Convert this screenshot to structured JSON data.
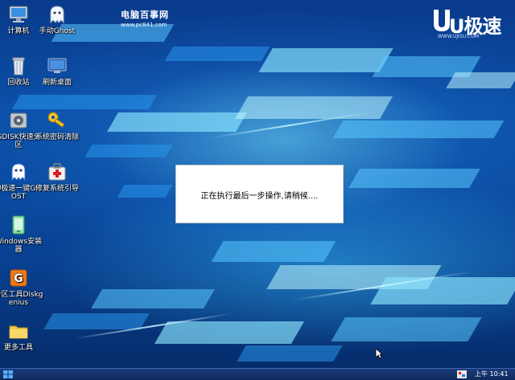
{
  "desktop": {
    "icons": [
      {
        "label": "计算机",
        "icon": "computer-icon"
      },
      {
        "label": "手动Ghost",
        "icon": "ghost-icon"
      },
      {
        "label": "回收站",
        "icon": "recycle-bin-icon"
      },
      {
        "label": "刷新桌面",
        "icon": "refresh-desktop-icon"
      },
      {
        "label": "GDISK快速分区",
        "icon": "gdisk-icon"
      },
      {
        "label": "系统密码清除",
        "icon": "key-icon"
      },
      {
        "label": "U极速一键GHOST",
        "icon": "ujisu-ghost-icon"
      },
      {
        "label": "修复系统引导",
        "icon": "repair-boot-icon"
      },
      {
        "label": "Windows安装器",
        "icon": "windows-installer-icon"
      },
      {
        "label": "分区工具Diskgenius",
        "icon": "diskgenius-icon"
      },
      {
        "label": "更多工具",
        "icon": "folder-icon"
      }
    ]
  },
  "branding": {
    "left_title": "电脑百事网",
    "left_url": "www.pc841.com",
    "right_title": "U极速",
    "right_url": "WWW.UJISU.COM"
  },
  "dialog": {
    "message": "正在执行最后一步操作,请稍候...."
  },
  "taskbar": {
    "clock": "上午 10:41"
  },
  "colors": {
    "desktop_background": "#0b4fa8",
    "taskbar": "#163468",
    "dialog": "#ffffff"
  }
}
